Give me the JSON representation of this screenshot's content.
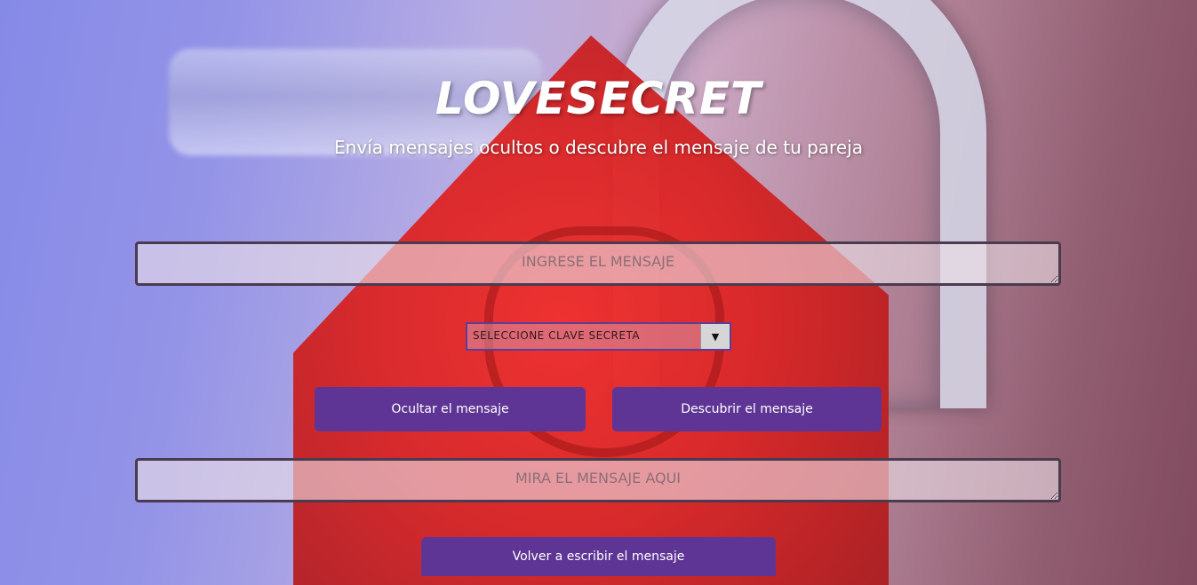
{
  "header": {
    "title": "LOVESECRET",
    "subtitle": "Envía mensajes ocultos o descubre el mensaje de tu pareja"
  },
  "form": {
    "message_input": {
      "placeholder": "INGRESE EL MENSAJE",
      "value": ""
    },
    "key_select": {
      "selected": "SELECCIONE CLAVE SECRETA",
      "arrow_icon": "▼"
    },
    "buttons": {
      "hide": "Ocultar el mensaje",
      "reveal": "Descubrir el mensaje",
      "rewrite": "Volver a escribir el mensaje"
    },
    "result_output": {
      "placeholder": "MIRA EL MENSAJE AQUI",
      "value": ""
    }
  },
  "colors": {
    "button": "#5e3595",
    "select_border": "#5b3d9b",
    "field_border": "#4a3b50",
    "text_light": "#ffffff"
  },
  "background": {
    "icon": "padlock-image"
  }
}
